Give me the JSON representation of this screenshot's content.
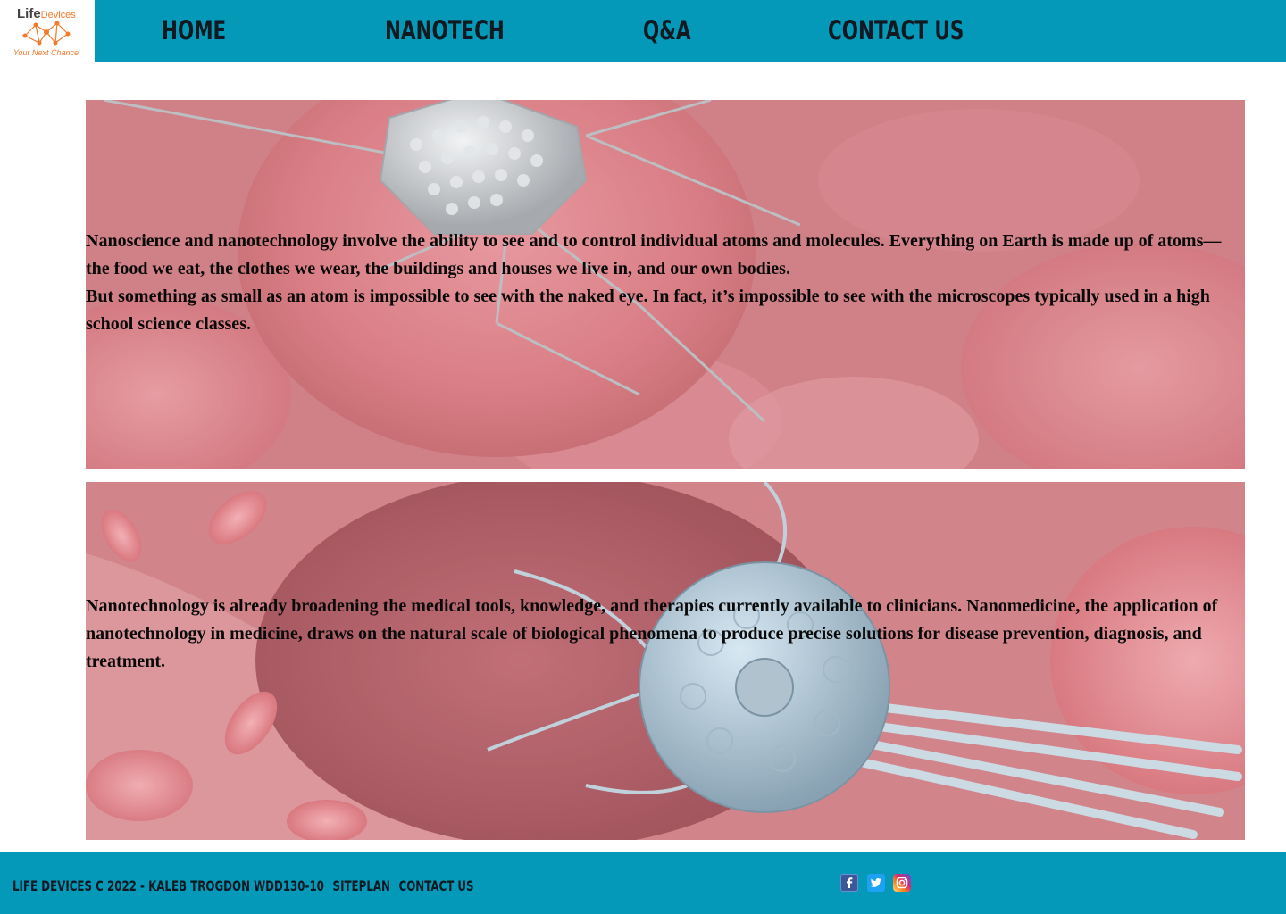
{
  "brand": {
    "name_primary": "Life",
    "name_secondary": "Devices",
    "tagline": "Your Next Chance",
    "accent_color": "#f27a2a",
    "logo_icon": "molecule-network-icon"
  },
  "nav": {
    "background": "#0499b9",
    "items": [
      {
        "label": "HOME"
      },
      {
        "label": "NANOTECH"
      },
      {
        "label": "Q&A"
      },
      {
        "label": "CONTACT US"
      }
    ]
  },
  "panels": [
    {
      "image": "nanobot-virus-in-blood-image",
      "text": "Nanoscience and nanotechnology involve the ability to see and to control individual atoms and molecules. Everything on Earth is made up of atoms—the food we eat, the clothes we wear, the buildings and houses we live in, and our own bodies.\nBut something as small as an atom is impossible to see with the naked eye. In fact, it’s impossible to see with the microscopes typically used in a high school science classes."
    },
    {
      "image": "nanobot-attacking-cell-image",
      "text": "Nanotechnology is already broadening the medical tools, knowledge, and therapies currently available to clinicians. Nanomedicine, the application of nanotechnology in medicine, draws on the natural scale of biological phenomena to produce precise solutions for disease prevention, diagnosis, and treatment."
    }
  ],
  "footer": {
    "background": "#0499b9",
    "credit": "LIFE DEVICES C 2022 - KALEB TROGDON WDD130-10",
    "links": [
      {
        "label": "SITEPLAN"
      },
      {
        "label": "CONTACT US"
      }
    ],
    "social_icons": [
      "facebook-icon",
      "twitter-icon",
      "instagram-icon"
    ]
  }
}
